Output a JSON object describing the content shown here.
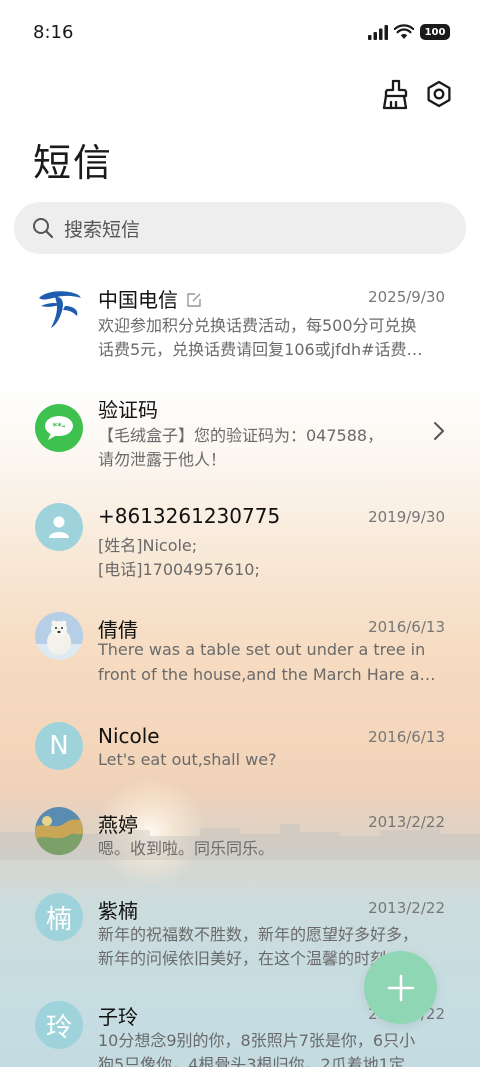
{
  "status_bar": {
    "time": "8:16",
    "battery": "100"
  },
  "header": {
    "title": "短信"
  },
  "search": {
    "placeholder": "搜索短信"
  },
  "conversations": [
    {
      "name": "中国电信",
      "date": "2025/9/30",
      "line1": "欢迎参加积分兑换话费活动，每500分可兑换",
      "line2": "话费5元，兑换话费请回复106或jfdh#话费…",
      "avatar": "china-telecom-logo"
    },
    {
      "name": "验证码",
      "date": "",
      "line1": "【毛绒盒子】您的验证码为：047588，",
      "line2": "请勿泄露于他人！",
      "avatar": "verification-code-icon"
    },
    {
      "name": "+8613261230775",
      "date": "2019/9/30",
      "line1": "[姓名]Nicole;",
      "line2": "[电话]17004957610;",
      "avatar": "contact-icon"
    },
    {
      "name": "倩倩",
      "date": "2016/6/13",
      "line1": "There was a table set out under a tree in",
      "line2": "front of the house,and the March Hare an…",
      "avatar": "polar-bear-photo"
    },
    {
      "name": "Nicole",
      "date": "2016/6/13",
      "line1": "Let's eat out,shall we?",
      "line2": "",
      "avatar_letter": "N"
    },
    {
      "name": "燕婷",
      "date": "2013/2/22",
      "line1": "嗯。收到啦。同乐同乐。",
      "line2": "",
      "avatar": "landscape-photo"
    },
    {
      "name": "紫楠",
      "date": "2013/2/22",
      "line1": "新年的祝福数不胜数，新年的愿望好多好多，",
      "line2": "新年的问候依旧美好，在这个温馨的时刻…",
      "avatar_letter": "楠"
    },
    {
      "name": "子玲",
      "date": "2013/2/22",
      "line1": "10分想念9别的你，8张照片7张是你，6只小",
      "line2": "狗5只像你，4根骨头3根归你，2爪着地1定",
      "avatar_letter": "玲"
    }
  ],
  "colors": {
    "accent_green": "#8fd6b4",
    "avatar_teal": "#9fd3dc",
    "telecom_blue": "#1e5cae"
  },
  "icons": [
    "signal-icon",
    "wifi-icon",
    "battery-icon",
    "clean-brush-icon",
    "settings-icon",
    "search-icon",
    "chevron-right-icon",
    "plus-icon"
  ]
}
